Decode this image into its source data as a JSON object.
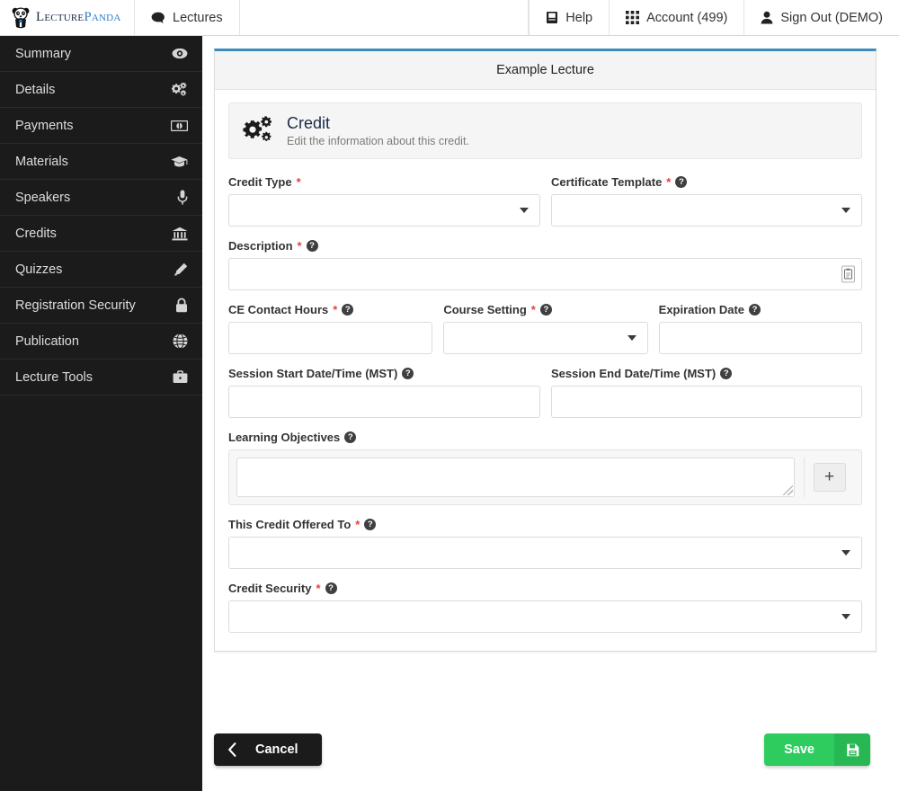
{
  "header": {
    "brand": {
      "word1": "Lecture",
      "word2": "Panda",
      "icon": "panda-logo-icon"
    },
    "left_nav": [
      {
        "label": "Lectures",
        "icon": "comment-icon"
      }
    ],
    "right_nav": [
      {
        "label": "Help",
        "icon": "book-icon"
      },
      {
        "label": "Account (499)",
        "icon": "grid-icon"
      },
      {
        "label": "Sign Out (DEMO)",
        "icon": "user-icon"
      }
    ]
  },
  "sidebar": {
    "items": [
      {
        "label": "Summary",
        "icon": "eye-icon"
      },
      {
        "label": "Details",
        "icon": "gears-icon"
      },
      {
        "label": "Payments",
        "icon": "money-icon"
      },
      {
        "label": "Materials",
        "icon": "graduation-cap-icon"
      },
      {
        "label": "Speakers",
        "icon": "microphone-icon"
      },
      {
        "label": "Credits",
        "icon": "bank-icon"
      },
      {
        "label": "Quizzes",
        "icon": "pencil-icon"
      },
      {
        "label": "Registration Security",
        "icon": "lock-icon"
      },
      {
        "label": "Publication",
        "icon": "globe-icon"
      },
      {
        "label": "Lecture Tools",
        "icon": "briefcase-icon"
      }
    ]
  },
  "panel": {
    "title": "Example Lecture",
    "section": {
      "icon": "gears-icon",
      "title": "Credit",
      "subtitle": "Edit the information about this credit."
    }
  },
  "form": {
    "credit_type": {
      "label": "Credit Type",
      "required": "*",
      "value": "",
      "has_help": false
    },
    "certificate_template": {
      "label": "Certificate Template",
      "required": "*",
      "value": "",
      "has_help": true
    },
    "description": {
      "label": "Description",
      "required": "*",
      "value": "",
      "has_help": true,
      "inner_icon": "clipboard-icon"
    },
    "ce_contact_hours": {
      "label": "CE Contact Hours",
      "required": "*",
      "value": "",
      "has_help": true
    },
    "course_setting": {
      "label": "Course Setting",
      "required": "*",
      "value": "",
      "has_help": true
    },
    "expiration_date": {
      "label": "Expiration Date",
      "required": "",
      "value": "",
      "has_help": true
    },
    "session_start": {
      "label": "Session Start Date/Time (MST)",
      "required": "",
      "value": "",
      "has_help": true
    },
    "session_end": {
      "label": "Session End Date/Time (MST)",
      "required": "",
      "value": "",
      "has_help": true
    },
    "learning_objectives": {
      "label": "Learning Objectives",
      "required": "",
      "value": "",
      "has_help": true,
      "add_label": "+"
    },
    "offered_to": {
      "label": "This Credit Offered To",
      "required": "*",
      "value": "",
      "has_help": true
    },
    "credit_security": {
      "label": "Credit Security",
      "required": "*",
      "value": "",
      "has_help": true
    }
  },
  "footer": {
    "cancel_label": "Cancel",
    "cancel_icon": "chevron-left-icon",
    "save_label": "Save",
    "save_icon": "floppy-disk-icon"
  },
  "help_glyph": "?",
  "colors": {
    "accent_blue": "#3c8dbc",
    "save_green": "#2ecc5f",
    "sidebar_dark": "#1b1b1b",
    "required_red": "#e8413a",
    "brand_navy": "#1b2a47",
    "brand_blue": "#2a7fc9"
  }
}
